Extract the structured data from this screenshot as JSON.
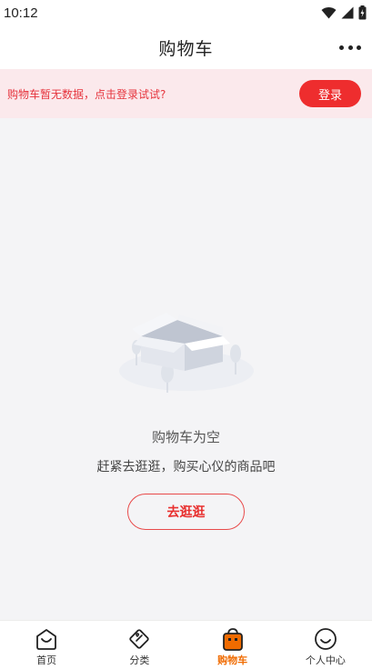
{
  "status_bar": {
    "time": "10:12"
  },
  "header": {
    "title": "购物车"
  },
  "login_banner": {
    "tip": "购物车暂无数据，点击登录试试?",
    "button_label": "登录"
  },
  "empty_state": {
    "title": "购物车为空",
    "subtitle": "赶紧去逛逛，购买心仪的商品吧",
    "button_label": "去逛逛"
  },
  "tab_bar": {
    "items": [
      {
        "label": "首页",
        "icon": "home-icon",
        "active": false
      },
      {
        "label": "分类",
        "icon": "category-icon",
        "active": false
      },
      {
        "label": "购物车",
        "icon": "cart-icon",
        "active": true
      },
      {
        "label": "个人中心",
        "icon": "profile-icon",
        "active": false
      }
    ]
  },
  "colors": {
    "accent_red": "#ee2d2e",
    "active_tab": "#f06b00",
    "banner_bg": "#fbe9ec",
    "page_bg": "#f4f4f6"
  }
}
